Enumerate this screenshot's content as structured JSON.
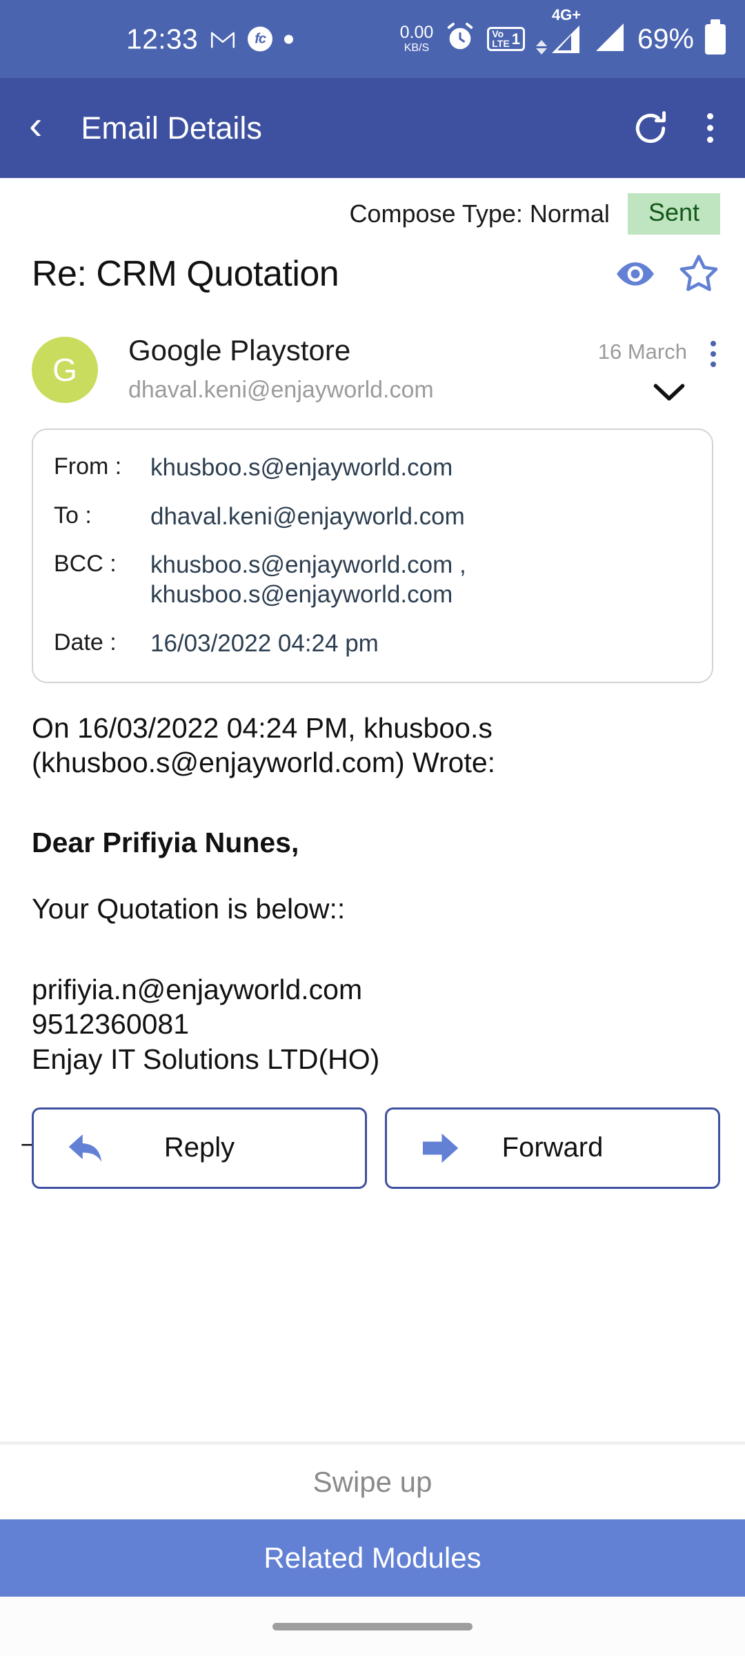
{
  "status_bar": {
    "clock": "12:33",
    "gmail_icon": "gmail-icon",
    "fc_badge": "fc",
    "dot_indicator": "dot-icon",
    "net_speed_value": "0.00",
    "net_speed_unit": "KB/S",
    "alarm_icon": "alarm-icon",
    "volte_vo": "Vo",
    "volte_lte": "LTE",
    "sim_number": "1",
    "network_type": "4G+",
    "battery_percent": "69%",
    "battery_icon": "battery-icon",
    "bg_color": "#4a64b0"
  },
  "app_bar": {
    "back_icon": "back-chevron-icon",
    "title": "Email Details",
    "refresh_icon": "refresh-icon",
    "menu_icon": "overflow-menu-icon",
    "bg_color": "#3e51a0"
  },
  "compose": {
    "label": "Compose Type:  Normal",
    "status_badge": "Sent",
    "badge_bg": "#bee5bf",
    "badge_fg": "#14571a"
  },
  "subject": {
    "text": "Re: CRM Quotation",
    "eye_icon": "eye-icon",
    "star_icon": "star-outline-icon",
    "icon_color": "#6280d4"
  },
  "sender": {
    "avatar_letter": "G",
    "avatar_color": "#cadc5e",
    "name": "Google Playstore",
    "email": "dhaval.keni@enjayworld.com",
    "date": "16 March",
    "menu_icon": "mail-overflow-menu-icon",
    "expand_icon": "chevron-down-icon"
  },
  "details": {
    "rows": [
      {
        "key": "From :",
        "value": "khusboo.s@enjayworld.com"
      },
      {
        "key": "To :",
        "value": "dhaval.keni@enjayworld.com"
      },
      {
        "key": "BCC :",
        "value": "khusboo.s@enjayworld.com ,\nkhusboo.s@enjayworld.com"
      },
      {
        "key": "Date :",
        "value": "16/03/2022 04:24 pm"
      }
    ]
  },
  "body": {
    "quote_header_l1": "On 16/03/2022 04:24 PM, khusboo.s",
    "quote_header_l2": "(khusboo.s@enjayworld.com) Wrote:",
    "greeting": "Dear Prifiyia Nunes,",
    "intro": "Your Quotation is below::",
    "sig_email": "prifiyia.n@enjayworld.com",
    "sig_phone": "9512360081",
    "sig_company": "Enjay IT Solutions LTD(HO)",
    "separator_artifact": "--"
  },
  "actions": {
    "reply_label": "Reply",
    "reply_icon": "reply-arrow-icon",
    "forward_label": "Forward",
    "forward_icon": "forward-arrow-icon",
    "border_color": "#3e51a0"
  },
  "bottom": {
    "swipe_hint": "Swipe up",
    "related_modules": "Related Modules",
    "related_bg": "#6280d4",
    "nav_pill": "gesture-nav-pill"
  }
}
